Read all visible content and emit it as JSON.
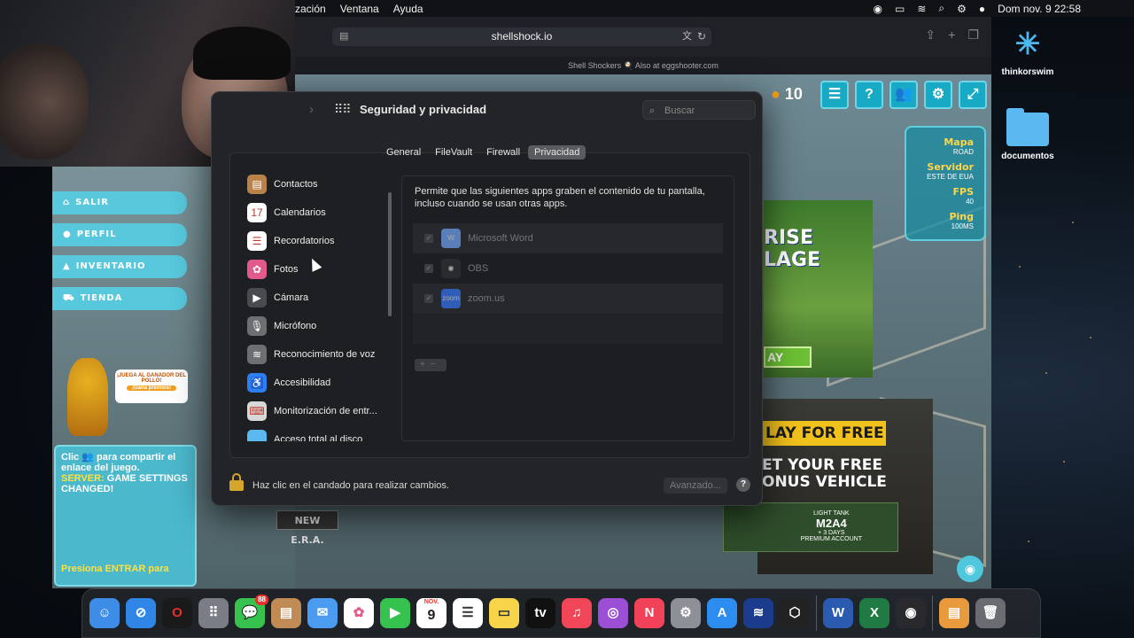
{
  "menubar": {
    "items": [
      "zación",
      "Ventana",
      "Ayuda"
    ],
    "datetime": "Dom nov. 9  22:58"
  },
  "browser": {
    "url": "shellshock.io",
    "bookmark": "Shell Shockers 🍳 Also at eggshooter.com"
  },
  "game": {
    "coins": "10",
    "stats": {
      "map_label": "Mapa",
      "map_value": "ROAD",
      "server_label": "Servidor",
      "server_value": "ESTE DE EUA",
      "fps_label": "FPS",
      "fps_value": "40",
      "ping_label": "Ping",
      "ping_value": "100MS"
    },
    "menu": [
      "SALIR",
      "PERFIL",
      "INVENTARIO",
      "TIENDA"
    ],
    "duck_bubble": "¡JUEGA AL GANADOR DEL POLLO!",
    "duck_prize": "¡Gana premios!",
    "chat_share": "Clic 👥 para compartir el enlace del juego.",
    "chat_server_label": "SERVER:",
    "chat_server_msg": " GAME SETTINGS CHANGED!",
    "chat_press": "Presiona ENTRAR para",
    "ad1_title": "RISE LAGE",
    "ad1_play": "AY",
    "ad2_play": "LAY FOR FREE",
    "ad2_bonus_l1": "ET YOUR FREE",
    "ad2_bonus_l2": "ONUS VEHICLE",
    "ad2_tank_type": "LIGHT TANK",
    "ad2_tank_name": "M2A4",
    "ad2_tank_days": "+ 3 DAYS",
    "ad2_tank_account": "PREMIUM ACCOUNT",
    "new_era": "NEW E.R.A."
  },
  "desktop": {
    "icon1": "thinkorswim",
    "icon2": "documentos"
  },
  "prefs": {
    "title": "Seguridad y privacidad",
    "search_placeholder": "Buscar",
    "tabs": [
      "General",
      "FileVault",
      "Firewall",
      "Privacidad"
    ],
    "list": [
      {
        "label": "Contactos",
        "icon": "contacts-icon",
        "color": "#b9824a",
        "glyph": "▤"
      },
      {
        "label": "Calendarios",
        "icon": "calendar-icon",
        "color": "#ffffff",
        "glyph": "17"
      },
      {
        "label": "Recordatorios",
        "icon": "reminders-icon",
        "color": "#ffffff",
        "glyph": "☰"
      },
      {
        "label": "Fotos",
        "icon": "photos-icon",
        "color": "#e25a8c",
        "glyph": "✿"
      },
      {
        "label": "Cámara",
        "icon": "camera-icon",
        "color": "#4a4b4e",
        "glyph": "▶"
      },
      {
        "label": "Micrófono",
        "icon": "microphone-icon",
        "color": "#6e6f72",
        "glyph": "🎙"
      },
      {
        "label": "Reconocimiento de voz",
        "icon": "speech-icon",
        "color": "#6e6f72",
        "glyph": "≋"
      },
      {
        "label": "Accesibilidad",
        "icon": "accessibility-icon",
        "color": "#2b7ff0",
        "glyph": "♿"
      },
      {
        "label": "Monitorización de entr...",
        "icon": "keyboard-icon",
        "color": "#d8d8d8",
        "glyph": "⌨"
      },
      {
        "label": "Acceso total al disco",
        "icon": "folder-icon",
        "color": "#5bb8f0",
        "glyph": ""
      }
    ],
    "description": "Permite que las siguientes apps graben el contenido de tu pantalla, incluso cuando se usan otras apps.",
    "apps": [
      {
        "name": "Microsoft Word",
        "icon": "word-icon",
        "glyph": "W",
        "bg": "#5a7fb8"
      },
      {
        "name": "OBS",
        "icon": "obs-icon",
        "glyph": "◉",
        "bg": "#2a2b2e"
      },
      {
        "name": "zoom.us",
        "icon": "zoom-icon",
        "glyph": "zoom",
        "bg": "#2f5db8"
      }
    ],
    "lock_text": "Haz clic en el candado para realizar cambios.",
    "advanced": "Avanzado...",
    "help": "?"
  },
  "dock": {
    "messages_badge": "88",
    "calendar_month": "NOV.",
    "calendar_day": "9",
    "tv_label": "tv"
  }
}
